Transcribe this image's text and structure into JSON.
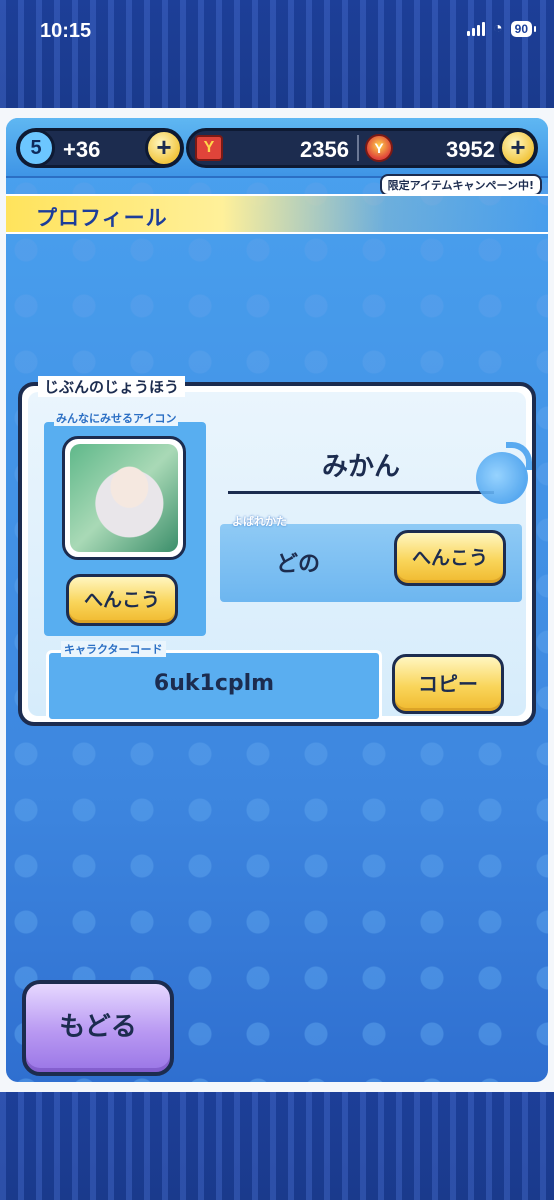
{
  "status_bar": {
    "time": "10:15",
    "battery": "90"
  },
  "currency": {
    "stamina_level": "5",
    "stamina_value": "+36",
    "plus_label": "+",
    "ycoin_value": "2356",
    "gem_value": "3952",
    "campaign_badge": "限定アイテムキャンペーン中!"
  },
  "title": "プロフィール",
  "profile": {
    "section_label": "じぶんのじょうほう",
    "icon_label": "みんなにみせるアイコン",
    "icon_change_button": "へんこう",
    "name": "みかん",
    "callname_label": "よばれかた",
    "callname_value": "どの",
    "callname_change_button": "へんこう",
    "code_label": "キャラクターコード",
    "code_value": "6uk1cplm",
    "copy_button": "コピー"
  },
  "back_button": "もどる",
  "colors": {
    "background_blue": "#4aa2ef",
    "outline_navy": "#1c2c4f",
    "button_yellow": "#f9d55a",
    "back_button_purple": "#b898f2"
  }
}
